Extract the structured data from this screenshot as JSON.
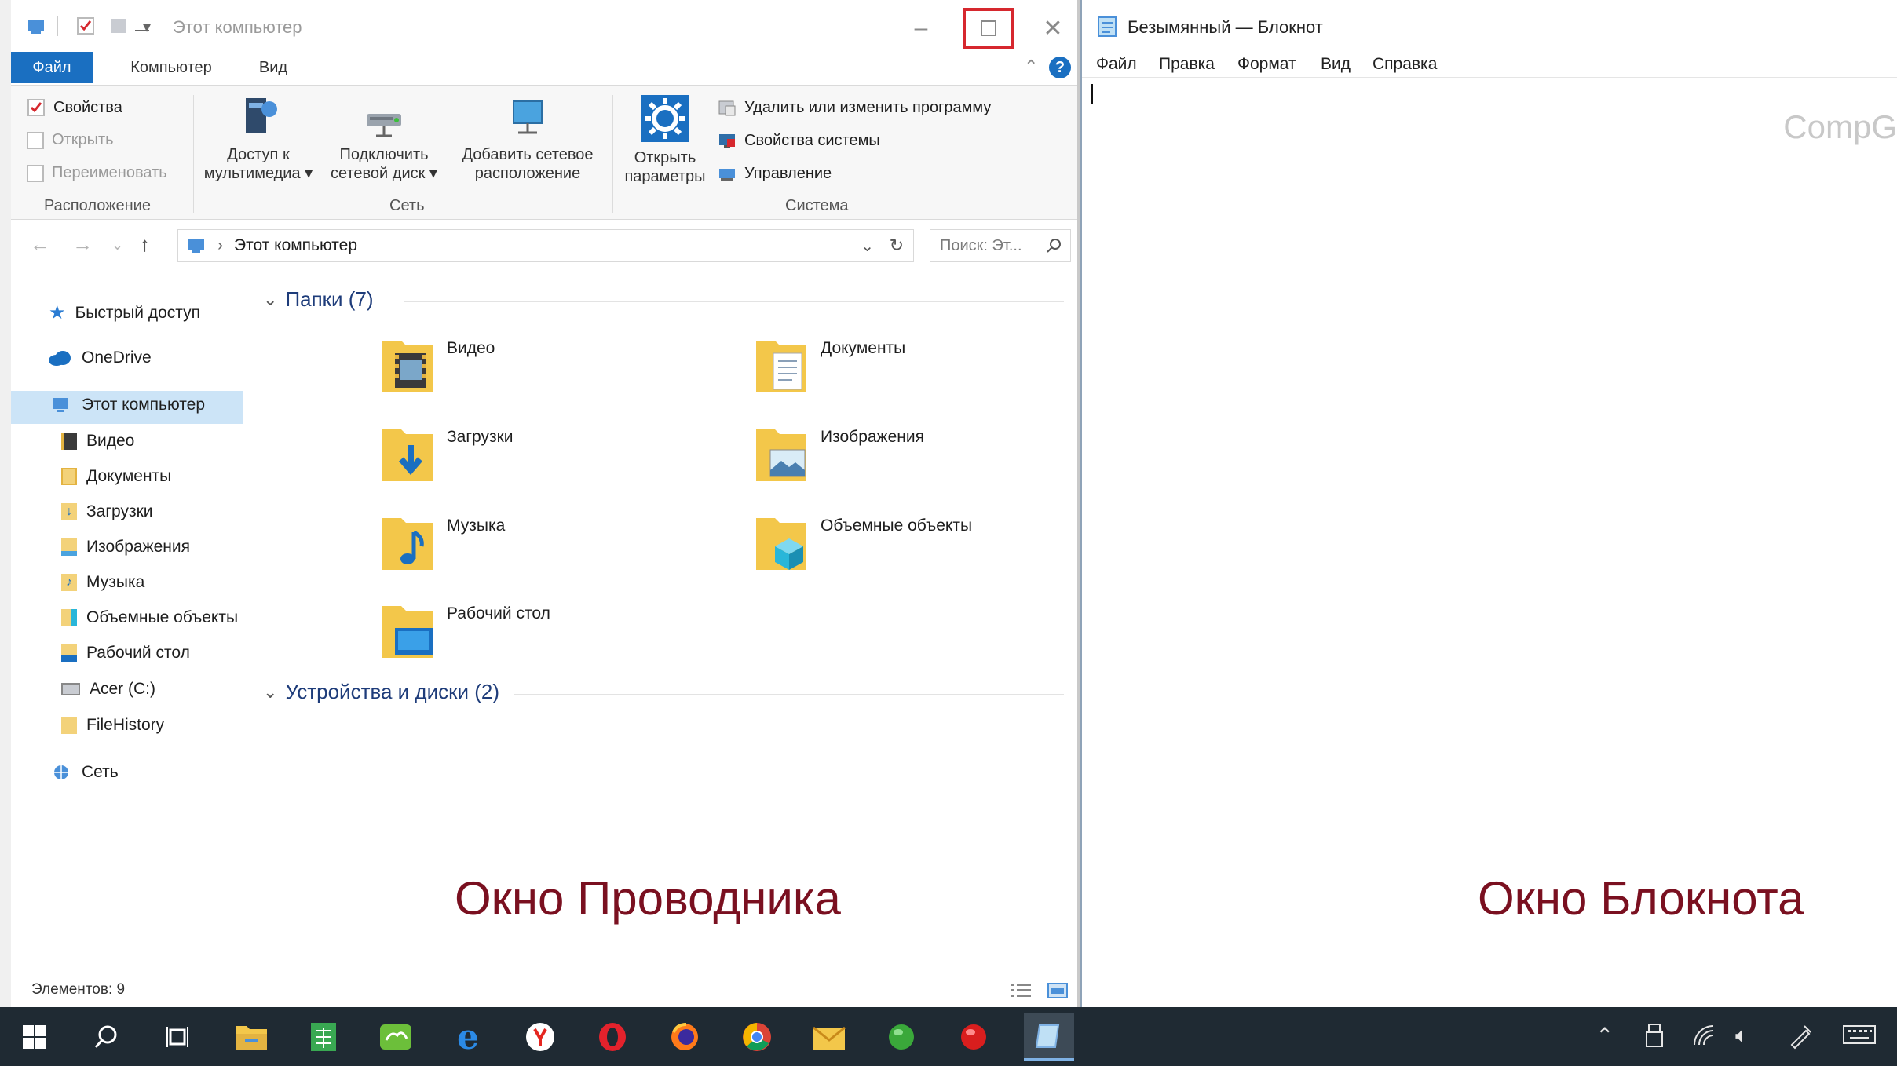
{
  "explorer": {
    "title": "Этот компьютер",
    "tabs": [
      "Файл",
      "Компьютер",
      "Вид"
    ],
    "ribbon": {
      "location": {
        "properties": "Свойства",
        "open": "Открыть",
        "rename": "Переименовать",
        "group": "Расположение"
      },
      "network": {
        "media_access": [
          "Доступ к",
          "мультимедиа ▾"
        ],
        "map_drive": [
          "Подключить",
          "сетевой диск ▾"
        ],
        "add_location": [
          "Добавить сетевое",
          "расположение"
        ],
        "group": "Сеть"
      },
      "system": {
        "open_settings": [
          "Открыть",
          "параметры"
        ],
        "uninstall": "Удалить или изменить программу",
        "system_properties": "Свойства системы",
        "manage": "Управление",
        "group": "Система"
      }
    },
    "address": {
      "path": "Этот компьютер",
      "search_placeholder": "Поиск: Эт..."
    },
    "nav": {
      "quick_access": "Быстрый доступ",
      "onedrive": "OneDrive",
      "this_pc": "Этот компьютер",
      "children": [
        "Видео",
        "Документы",
        "Загрузки",
        "Изображения",
        "Музыка",
        "Объемные объекты",
        "Рабочий стол",
        "Acer (C:)",
        "FileHistory"
      ],
      "network": "Сеть"
    },
    "folders_header": "Папки (7)",
    "folders": [
      "Видео",
      "Документы",
      "Загрузки",
      "Изображения",
      "Музыка",
      "Объемные объекты",
      "Рабочий стол"
    ],
    "devices_header": "Устройства и диски (2)",
    "status": "Элементов: 9",
    "caption": "Окно Проводника"
  },
  "notepad": {
    "title": "Безымянный — Блокнот",
    "menu": [
      "Файл",
      "Правка",
      "Формат",
      "Вид",
      "Справка"
    ],
    "watermark": "CompG",
    "caption": "Окно Блокнота"
  },
  "colors": {
    "accent": "#1a6fc1",
    "highlight": "#d6282e",
    "caption": "#7a1020",
    "taskbar": "#1f2a33",
    "selection": "#cce4f7"
  }
}
